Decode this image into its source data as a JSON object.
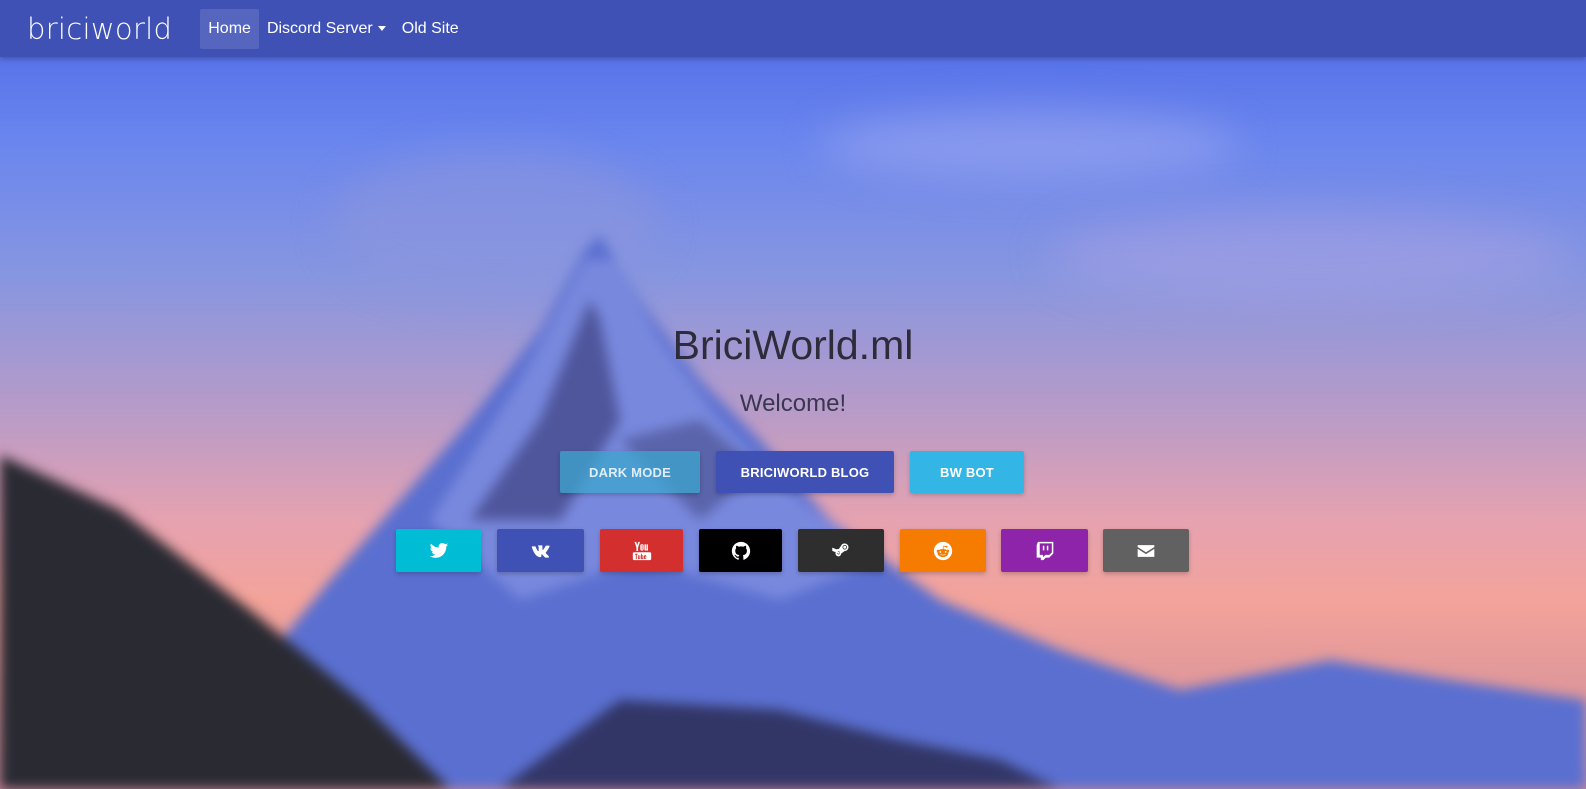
{
  "navbar": {
    "brand": "briciworld",
    "items": [
      {
        "label": "Home",
        "active": true
      },
      {
        "label": "Discord Server",
        "dropdown": true
      },
      {
        "label": "Old Site"
      }
    ]
  },
  "hero": {
    "title": "BriciWorld.ml",
    "subtitle": "Welcome!",
    "buttons": [
      {
        "label": "DARK MODE",
        "color": "#3ca5cd"
      },
      {
        "label": "BRICIWORLD BLOG",
        "color": "#3f51b5"
      },
      {
        "label": "BW BOT",
        "color": "#33b5e5"
      }
    ]
  },
  "social": [
    {
      "icon": "twitter-icon",
      "color": "#00bcd4"
    },
    {
      "icon": "vk-icon",
      "color": "#3f51b5"
    },
    {
      "icon": "youtube-icon",
      "color": "#d32f2f"
    },
    {
      "icon": "github-icon",
      "color": "#000000"
    },
    {
      "icon": "steam-icon",
      "color": "#2e2e2e"
    },
    {
      "icon": "reddit-icon",
      "color": "#f57c00"
    },
    {
      "icon": "twitch-icon",
      "color": "#8e24aa"
    },
    {
      "icon": "email-icon",
      "color": "#616161"
    }
  ]
}
